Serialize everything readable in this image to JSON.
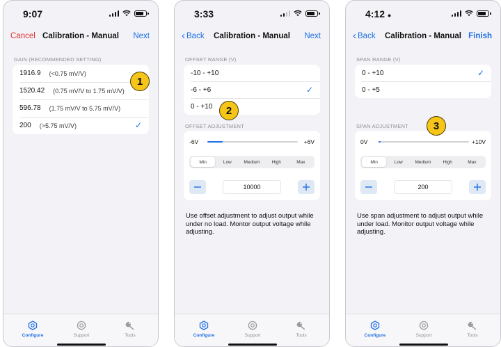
{
  "colors": {
    "accent": "#1f6fe5",
    "cancel": "#e0312a",
    "marker": "#f5c518"
  },
  "tabs": [
    {
      "label": "Configure",
      "icon": "configure-icon"
    },
    {
      "label": "Support",
      "icon": "support-icon"
    },
    {
      "label": "Tools",
      "icon": "wrench-icon"
    }
  ],
  "screens": [
    {
      "time": "9:07",
      "nav": {
        "left": "Cancel",
        "title": "Calibration - Manual",
        "right": "Next"
      },
      "gain": {
        "header": "GAIN (RECOMMENDED SETTING)",
        "options": [
          {
            "value": "1916.9",
            "range": "(<0.75 mV/V)",
            "selected": false
          },
          {
            "value": "1520.42",
            "range": "(0.75 mV/V to 1.75 mV/V)",
            "selected": false
          },
          {
            "value": "596.78",
            "range": "(1.75 mV/V to 5.75 mV/V)",
            "selected": false
          },
          {
            "value": "200",
            "range": "(>5.75 mV/V)",
            "selected": true
          }
        ]
      },
      "marker": "1"
    },
    {
      "time": "3:33",
      "nav": {
        "left": "Back",
        "title": "Calibration - Manual",
        "right": "Next"
      },
      "range": {
        "header": "OFFSET RANGE (V)",
        "options": [
          {
            "label": "-10 - +10",
            "selected": false
          },
          {
            "label": "-6 - +6",
            "selected": true
          },
          {
            "label": "0 - +10",
            "selected": false
          }
        ]
      },
      "adjust": {
        "header": "OFFSET ADJUSTMENT",
        "min_label": "-6V",
        "max_label": "+6V",
        "level": 0.17,
        "steps": [
          "Min",
          "Low",
          "Medium",
          "High",
          "Max"
        ],
        "selected_step": "Min",
        "value": "10000"
      },
      "help": "Use offset adjustment to adjust output while under no load.  Montor output voltage while adjusting.",
      "marker": "2"
    },
    {
      "time": "4:12",
      "nav": {
        "left": "Back",
        "title": "Calibration - Manual",
        "right": "Finish"
      },
      "range": {
        "header": "SPAN RANGE (V)",
        "options": [
          {
            "label": "0 - +10",
            "selected": true
          },
          {
            "label": "0 - +5",
            "selected": false
          }
        ]
      },
      "adjust": {
        "header": "SPAN ADJUSTMENT",
        "min_label": "0V",
        "max_label": "+10V",
        "level": 0.02,
        "steps": [
          "Min",
          "Low",
          "Medium",
          "High",
          "Max"
        ],
        "selected_step": "Min",
        "value": "200"
      },
      "help": "Use span adjustment to adjust output while under load.  Monitor output voltage while adjusting.",
      "marker": "3"
    }
  ]
}
